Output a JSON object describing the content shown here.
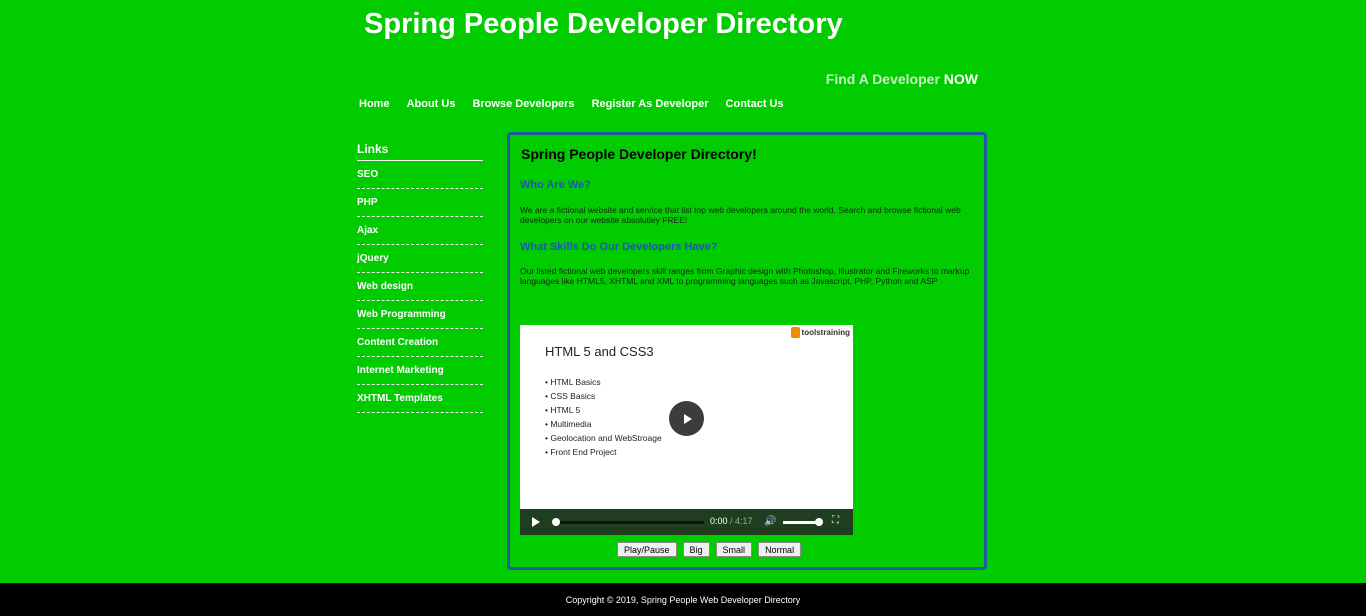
{
  "header": {
    "title": "Spring People Developer Directory",
    "tagline_part1": "Find A Developer",
    "tagline_part2": "NOW"
  },
  "nav": [
    {
      "label": "Home"
    },
    {
      "label": "About Us"
    },
    {
      "label": "Browse Developers"
    },
    {
      "label": "Register As Developer"
    },
    {
      "label": "Contact Us"
    }
  ],
  "sidebar": {
    "heading": "Links",
    "items": [
      {
        "label": "SEO"
      },
      {
        "label": "PHP"
      },
      {
        "label": "Ajax"
      },
      {
        "label": "jQuery"
      },
      {
        "label": "Web design"
      },
      {
        "label": "Web Programming"
      },
      {
        "label": "Content Creation"
      },
      {
        "label": "Internet Marketing"
      },
      {
        "label": "XHTML Templates"
      }
    ]
  },
  "content": {
    "heading": "Spring People Developer Directory!",
    "section1_title": "Who Are We?",
    "section1_text": "We are a fictional website and service that list top web developers around the world. Search and browse fictional web developers on our website absolutley FREE!",
    "section2_title": "What Skills Do Our Developers Have?",
    "section2_text": "Our listed fictional web developers skill ranges from Graphic design with Photoshop, Illustrator and Fireworks to markup languages like HTML5, XHTML and XML to programming languages such as Javascript, PHP, Python and ASP"
  },
  "video": {
    "slide_title": "HTML 5 and CSS3",
    "brand": "toolstraining",
    "bullets": [
      "HTML Basics",
      "CSS Basics",
      "HTML 5",
      "Multimedia",
      "Geolocation and WebStroage",
      "Front End Project"
    ],
    "current_time": "0:00",
    "duration": "/ 4:17",
    "progress": 0,
    "volume": 1
  },
  "buttons": {
    "play_pause": "Play/Pause",
    "big": "Big",
    "small": "Small",
    "normal": "Normal"
  },
  "footer": {
    "copyright": "Copyright © 2019, Spring People Web Developer Directory"
  }
}
